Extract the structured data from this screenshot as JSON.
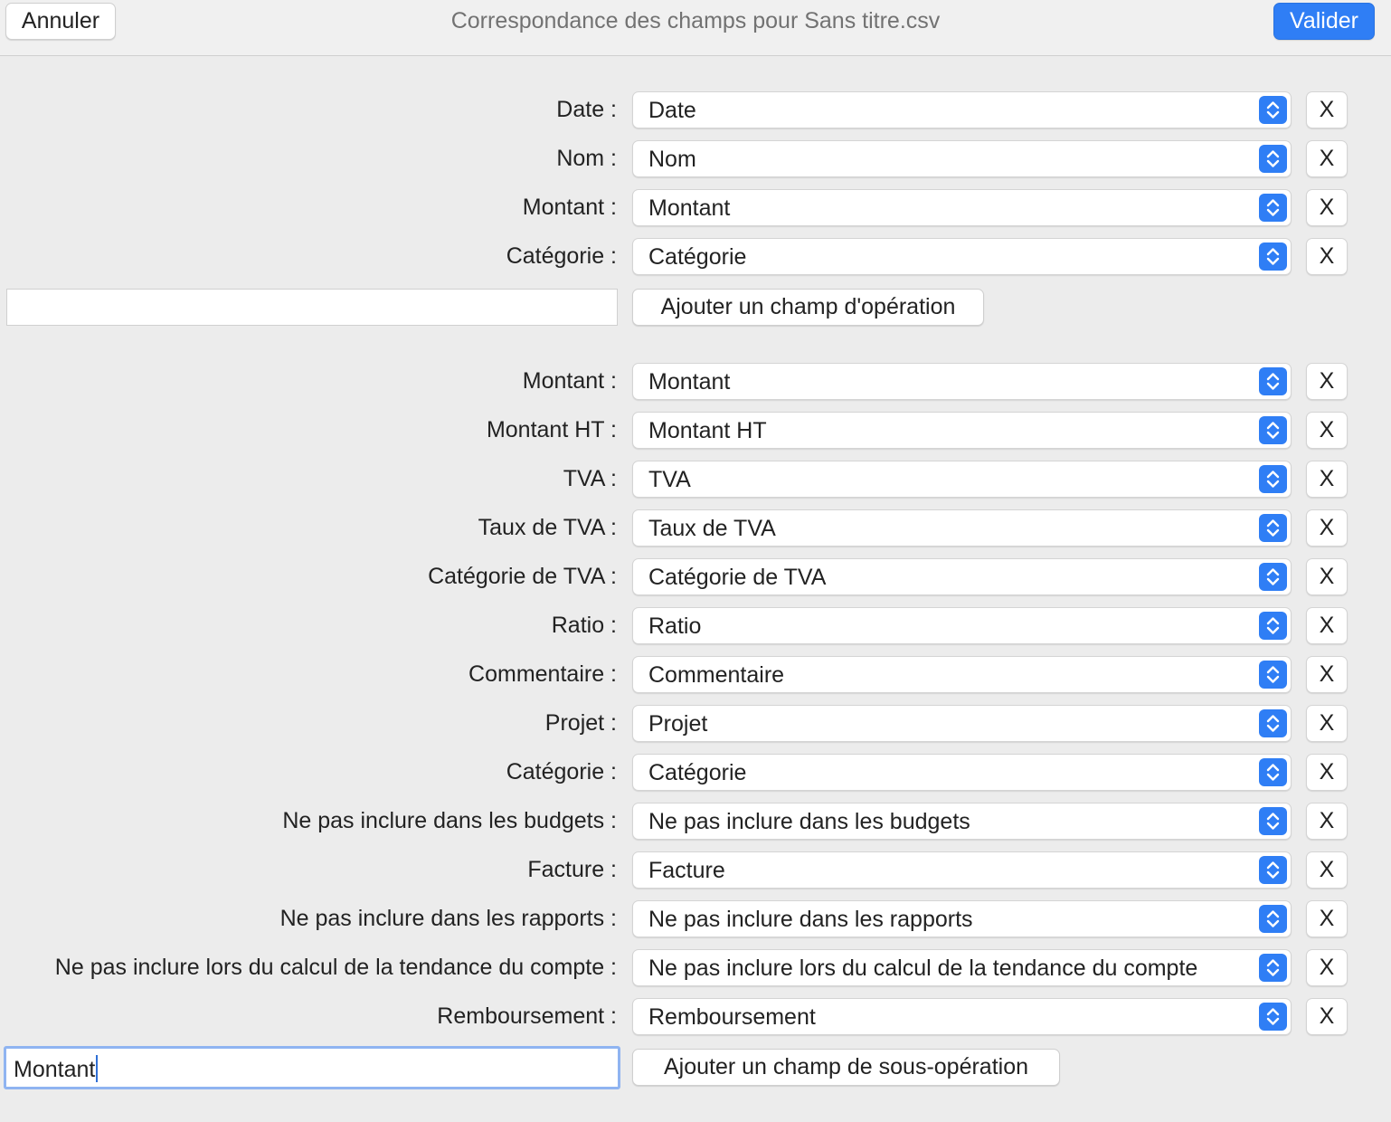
{
  "window": {
    "title": "Correspondance des champs pour Sans titre.csv",
    "cancel_label": "Annuler",
    "confirm_label": "Valider"
  },
  "colors": {
    "accent": "#2f7ef5",
    "background": "#ececec",
    "focus_ring": "#8fb4f1"
  },
  "transaction_section": {
    "rows": [
      {
        "label": "Date :",
        "value": "Date",
        "remove_label": "X"
      },
      {
        "label": "Nom :",
        "value": "Nom",
        "remove_label": "X"
      },
      {
        "label": "Montant :",
        "value": "Montant",
        "remove_label": "X"
      },
      {
        "label": "Catégorie :",
        "value": "Catégorie",
        "remove_label": "X"
      }
    ],
    "new_field_value": "",
    "add_button_label": "Ajouter un champ d'opération"
  },
  "split_section": {
    "rows": [
      {
        "label": "Montant :",
        "value": "Montant",
        "remove_label": "X"
      },
      {
        "label": "Montant HT :",
        "value": "Montant HT",
        "remove_label": "X"
      },
      {
        "label": "TVA :",
        "value": "TVA",
        "remove_label": "X"
      },
      {
        "label": "Taux de TVA :",
        "value": "Taux de TVA",
        "remove_label": "X"
      },
      {
        "label": "Catégorie de TVA :",
        "value": "Catégorie de TVA",
        "remove_label": "X"
      },
      {
        "label": "Ratio :",
        "value": "Ratio",
        "remove_label": "X"
      },
      {
        "label": "Commentaire :",
        "value": "Commentaire",
        "remove_label": "X"
      },
      {
        "label": "Projet :",
        "value": "Projet",
        "remove_label": "X"
      },
      {
        "label": "Catégorie :",
        "value": "Catégorie",
        "remove_label": "X"
      },
      {
        "label": "Ne pas inclure dans les budgets :",
        "value": "Ne pas inclure dans les budgets",
        "remove_label": "X"
      },
      {
        "label": "Facture :",
        "value": "Facture",
        "remove_label": "X"
      },
      {
        "label": "Ne pas inclure dans les rapports :",
        "value": "Ne pas inclure dans les rapports",
        "remove_label": "X"
      },
      {
        "label": "Ne pas inclure lors du calcul de la tendance du compte :",
        "value": "Ne pas inclure lors du calcul de la tendance du compte",
        "remove_label": "X"
      },
      {
        "label": "Remboursement :",
        "value": "Remboursement",
        "remove_label": "X"
      }
    ],
    "new_field_value": "Montant",
    "add_button_label": "Ajouter un champ de sous-opération"
  }
}
